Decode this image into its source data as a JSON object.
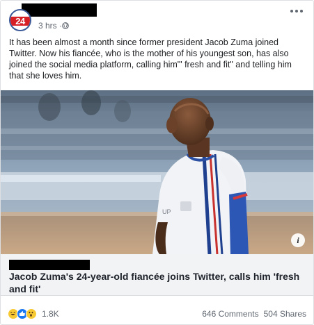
{
  "post": {
    "page_logo_text": "24",
    "timestamp": "3 hrs ·",
    "privacy_icon": "globe-icon",
    "body": "It has been almost a month since former president Jacob Zuma joined Twitter. Now his fiancée, who is the mother of his youngest son, has also joined the social media platform, calling him\"' fresh and fit\" and telling him that she loves him."
  },
  "link": {
    "title": "Jacob Zuma's 24-year-old fiancée joins Twitter, calls him 'fresh and fit'",
    "info_icon": "i"
  },
  "stats": {
    "reaction_icons": [
      "haha-reaction-icon",
      "like-reaction-icon",
      "wow-reaction-icon"
    ],
    "reaction_count": "1.8K",
    "comments": "646 Comments",
    "shares": "504 Shares"
  },
  "colors": {
    "brand_red": "#d71f26",
    "facebook_blue": "#1877f2",
    "meta_text": "#606770"
  }
}
